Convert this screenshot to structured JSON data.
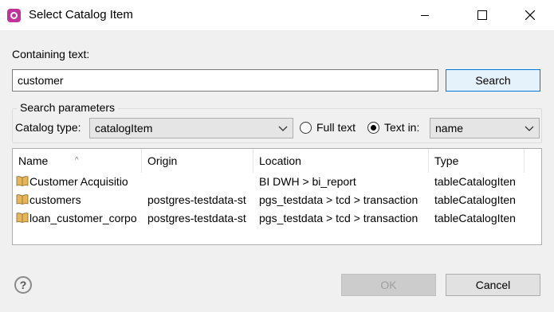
{
  "window": {
    "title": "Select Catalog Item"
  },
  "search": {
    "containing_label": "Containing text:",
    "value": "customer",
    "search_button": "Search"
  },
  "params": {
    "group_title": "Search parameters",
    "catalog_type_label": "Catalog type:",
    "catalog_type_value": "catalogItem",
    "full_text_label": "Full text",
    "text_in_label": "Text in:",
    "text_in_value": "name",
    "selected_mode": "text_in"
  },
  "table": {
    "columns": [
      "Name",
      "Origin",
      "Location",
      "Type"
    ],
    "rows": [
      {
        "name": "Customer Acquisitio",
        "origin": "",
        "location": "BI DWH > bi_report",
        "type": "tableCatalogIten"
      },
      {
        "name": "customers",
        "origin": "postgres-testdata-st",
        "location": "pgs_testdata > tcd > transaction",
        "type": "tableCatalogIten"
      },
      {
        "name": "loan_customer_corpo",
        "origin": "postgres-testdata-st",
        "location": "pgs_testdata > tcd > transaction",
        "type": "tableCatalogIten"
      }
    ]
  },
  "footer": {
    "ok": "OK",
    "cancel": "Cancel"
  },
  "icons": {
    "app": "app-logo-icon",
    "row": "book-icon",
    "help": "help-icon"
  },
  "colors": {
    "primary_border": "#0078d7",
    "app_icon": "#c1339b",
    "book": "#c8963e"
  }
}
